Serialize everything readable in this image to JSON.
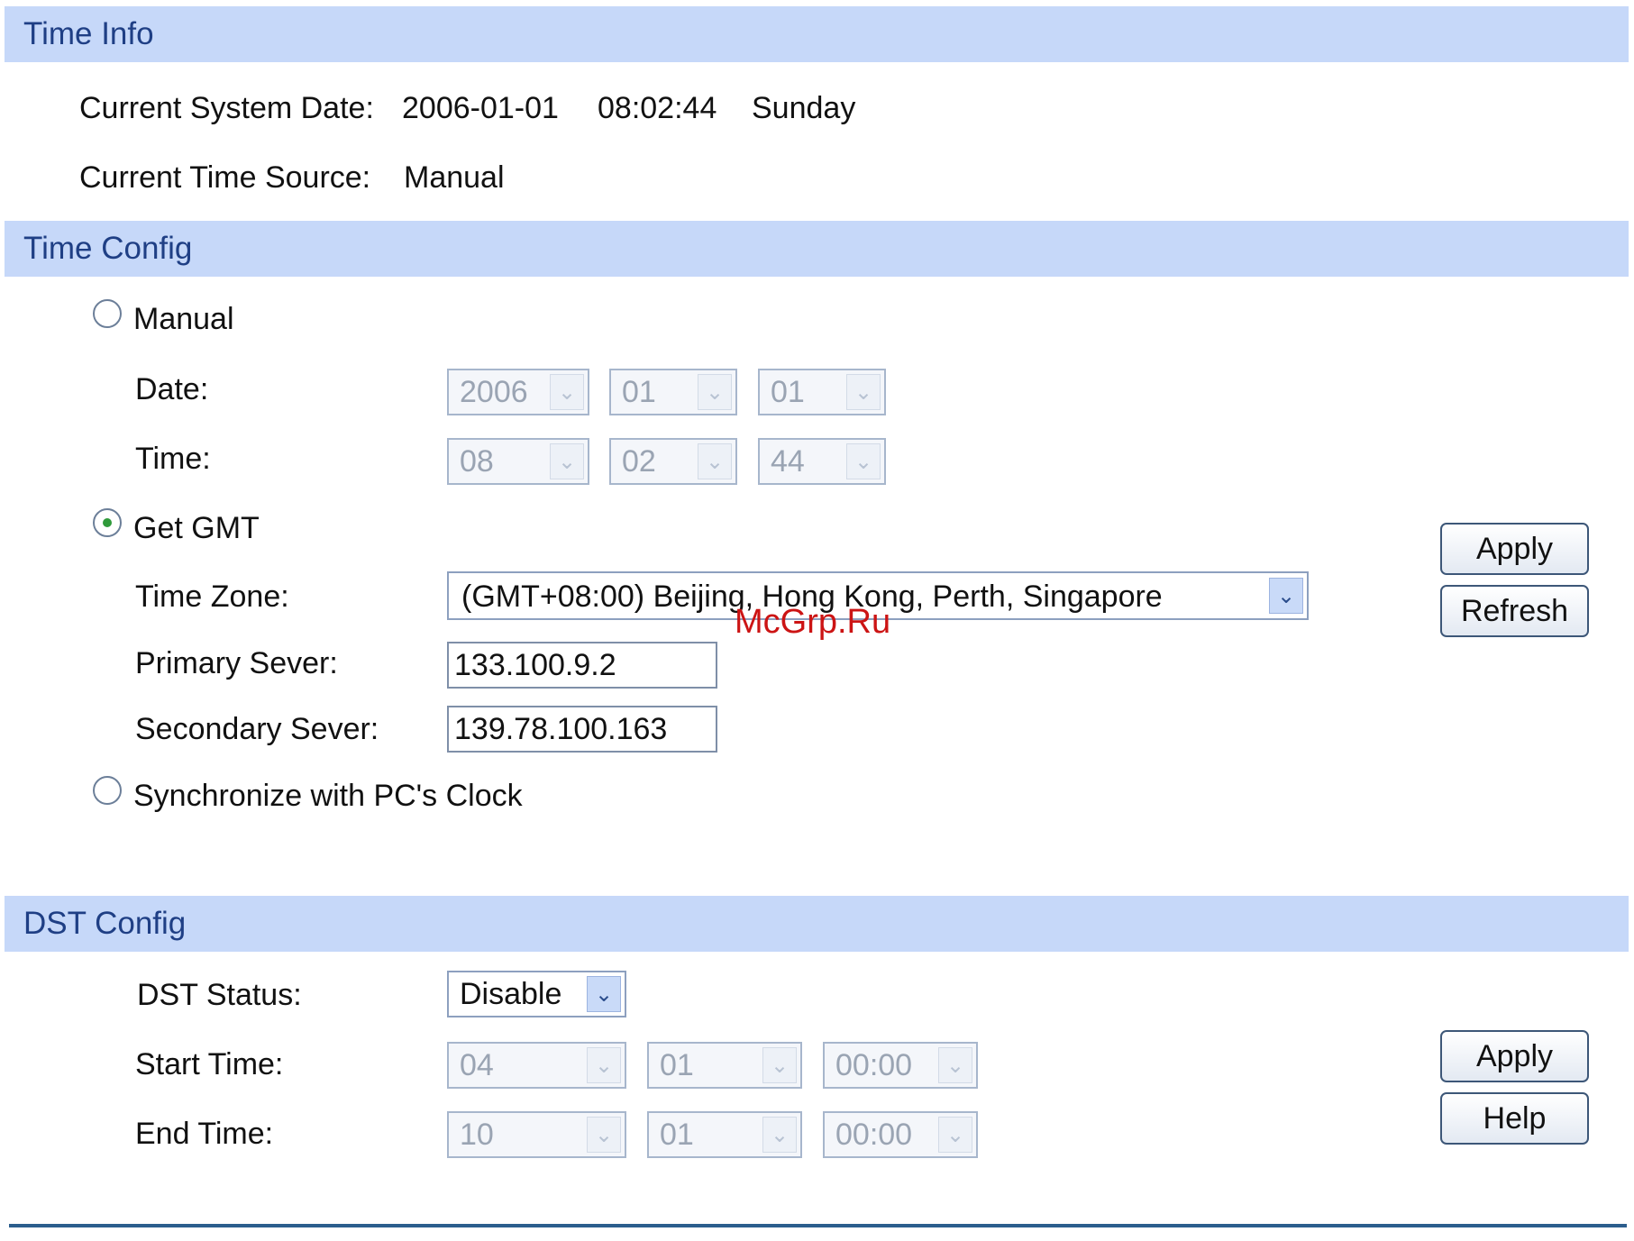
{
  "time_info": {
    "header": "Time Info",
    "system_date_label": "Current System Date:",
    "system_date": "2006-01-01",
    "system_time": "08:02:44",
    "system_day": "Sunday",
    "time_source_label": "Current Time Source:",
    "time_source": "Manual"
  },
  "time_config": {
    "header": "Time Config",
    "manual_label": "Manual",
    "date_label": "Date:",
    "date_year": "2006",
    "date_month": "01",
    "date_day": "01",
    "time_label": "Time:",
    "time_hour": "08",
    "time_minute": "02",
    "time_second": "44",
    "get_gmt_label": "Get GMT",
    "time_zone_label": "Time Zone:",
    "time_zone": "(GMT+08:00) Beijing, Hong Kong, Perth, Singapore",
    "primary_server_label": "Primary Sever:",
    "primary_server": "133.100.9.2",
    "secondary_server_label": "Secondary Sever:",
    "secondary_server": "139.78.100.163",
    "sync_pc_label": "Synchronize with PC's Clock",
    "selected_mode": "Get GMT",
    "apply_label": "Apply",
    "refresh_label": "Refresh"
  },
  "dst_config": {
    "header": "DST Config",
    "status_label": "DST Status:",
    "status": "Disable",
    "start_label": "Start Time:",
    "start_month": "04",
    "start_day": "01",
    "start_time": "00:00",
    "end_label": "End Time:",
    "end_month": "10",
    "end_day": "01",
    "end_time": "00:00",
    "apply_label": "Apply",
    "help_label": "Help"
  },
  "watermark": "McGrp.Ru",
  "icons": {
    "dropdown": "chevron-down-icon",
    "radio": "radio-icon"
  },
  "colors": {
    "header_bg": "#c6d8f9",
    "header_text": "#1f3f85",
    "watermark": "#cc1414"
  }
}
